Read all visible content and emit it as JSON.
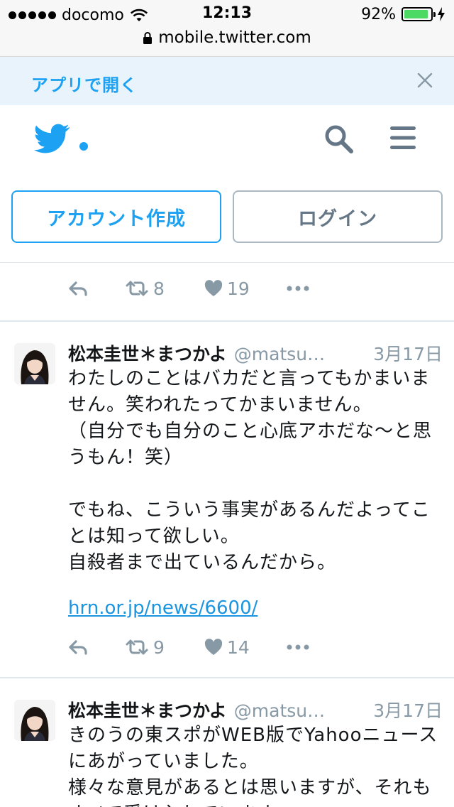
{
  "status_bar": {
    "carrier": "docomo",
    "time": "12:13",
    "battery": "92%",
    "battery_level": 0.92,
    "url": "mobile.twitter.com"
  },
  "app_banner": {
    "label": "アプリで開く"
  },
  "header": {
    "signup_label": "アカウント作成",
    "login_label": "ログイン"
  },
  "timeline": {
    "top_card": {
      "retweets": "8",
      "likes": "19"
    },
    "tweets": [
      {
        "name": "松本圭世＊まつかよ",
        "handle": "@matsu…",
        "date": "3月17日",
        "text": "わたしのことはバカだと言ってもかまいません。笑われたってかまいません。\n（自分でも自分のこと心底アホだな〜と思うもん！笑）\n\nでもね、こういう事実があるんだよってことは知って欲しい。\n自殺者まで出ているんだから。",
        "link": "hrn.or.jp/news/6600/",
        "retweets": "9",
        "likes": "14"
      },
      {
        "name": "松本圭世＊まつかよ",
        "handle": "@matsu…",
        "date": "3月17日",
        "text": "きのうの東スポがWEB版でYahooニュースにあがっていました。\n様々な意見があるとは思いますが、それもすべて受け入れています。"
      }
    ]
  },
  "colors": {
    "accent": "#1da1f2",
    "muted": "#8899a6",
    "link": "#1b95e0"
  }
}
